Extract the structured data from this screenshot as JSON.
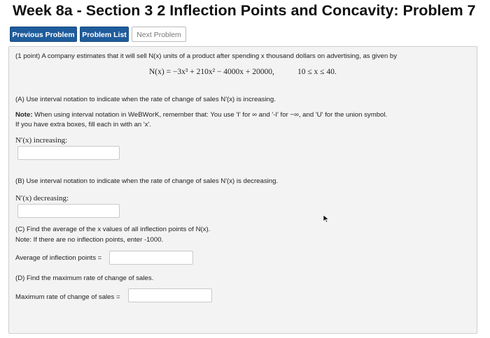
{
  "page": {
    "title": "Week 8a - Section 3 2 Inflection Points and Concavity: Problem 7"
  },
  "nav": {
    "previous": "Previous Problem",
    "list": "Problem List",
    "next": "Next Problem"
  },
  "problem": {
    "intro": "(1 point) A company estimates that it will sell N(x) units of a product after spending x thousand dollars on advertising, as given by",
    "formula": "N(x) = −3x³ + 210x² − 4000x + 20000,",
    "domain": "10 ≤ x ≤ 40.",
    "part_a": "(A) Use interval notation to indicate when the rate of change of sales N′(x) is increasing.",
    "note_label": "Note:",
    "note_text": " When using interval notation in WeBWorK, remember that: You use 'I' for ∞ and '-I' for −∞, and 'U' for the union symbol.",
    "note_text2": "If you have extra boxes, fill each in with an 'x'.",
    "label_a": "N′(x) increasing:",
    "part_b": "(B) Use interval notation to indicate when the rate of change of sales N′(x) is decreasing.",
    "label_b": "N′(x) decreasing:",
    "part_c": "(C) Find the average of the x values of all inflection points of N(x).",
    "part_c_note": "Note: If there are no inflection points, enter -1000.",
    "label_c": "Average of inflection points =",
    "part_d": "(D) Find the maximum rate of change of sales.",
    "label_d": "Maximum rate of change of sales ="
  },
  "answers": {
    "a": "",
    "b": "",
    "c": "",
    "d": ""
  }
}
